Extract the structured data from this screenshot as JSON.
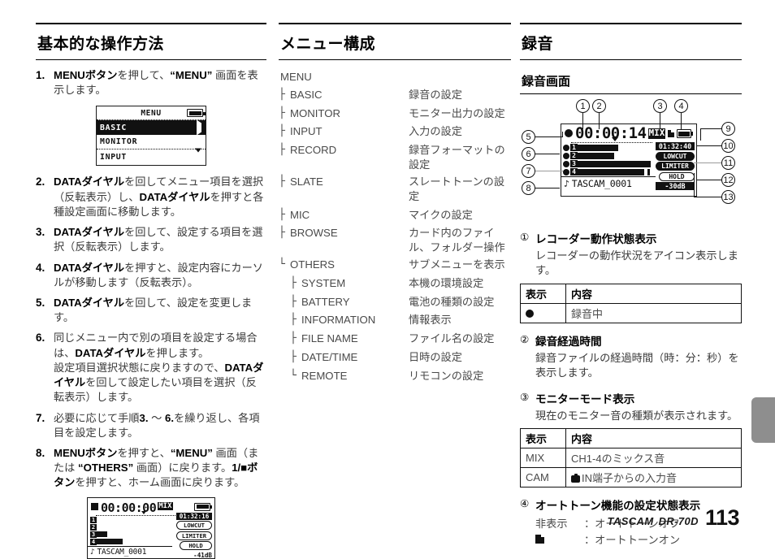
{
  "footer": {
    "brand": "TASCAM",
    "model": "DR-70D",
    "page_number": "113"
  },
  "col1": {
    "heading": "基本的な操作方法",
    "steps": [
      {
        "num": "1.",
        "html": "<span class=\"b\">MENU</span><span class=\"b\">ボタン</span>を押して、<span class=\"q\">“MENU”</span> 画面を表示します。"
      },
      {
        "num": "2.",
        "html": "<span class=\"b\">DATAダイヤル</span>を回してメニュー項目を選択（反転表示）し、<span class=\"b\">DATAダイヤル</span>を押すと各種設定画面に移動します。"
      },
      {
        "num": "3.",
        "html": "<span class=\"b\">DATAダイヤル</span>を回して、設定する項目を選択（反転表示）します。"
      },
      {
        "num": "4.",
        "html": "<span class=\"b\">DATAダイヤル</span>を押すと、設定内容にカーソルが移動します（反転表示）。"
      },
      {
        "num": "5.",
        "html": "<span class=\"b\">DATAダイヤル</span>を回して、設定を変更します。"
      },
      {
        "num": "6.",
        "html": "同じメニュー内で別の項目を設定する場合は、<span class=\"b\">DATAダイヤル</span>を押します。<br>設定項目選択状態に戻りますので、<span class=\"b\">DATAダイヤル</span>を回して設定したい項目を選択（反転表示）します。"
      },
      {
        "num": "7.",
        "html": "必要に応じて手順<span class=\"b\">3.</span> 〜 <span class=\"b\">6.</span>を繰り返し、各項目を設定します。"
      },
      {
        "num": "8.",
        "html": "<span class=\"b\">MENU</span><span class=\"b\">ボタン</span>を押すと、<span class=\"q\">“MENU”</span> 画面（または <span class=\"q\">“OTHERS”</span> 画面）に戻ります。<span class=\"b\">1/■ボタン</span>を押すと、ホーム画面に戻ります。"
      }
    ],
    "menu_lcd": {
      "title": "MENU",
      "battery_icon": "battery-icon",
      "rows": [
        {
          "label": "BASIC",
          "selected": true,
          "arrow": "right-arrow-icon"
        },
        {
          "label": "MONITOR",
          "selected": false,
          "arrow": ""
        },
        {
          "label": "INPUT",
          "selected": false,
          "arrow": "down-arrow-icon"
        }
      ]
    },
    "home_lcd": {
      "status_icon": "stop-icon",
      "elapsed_time": "00:00:00",
      "monitor_mode": "MIX",
      "battery_icon": "battery-icon",
      "remaining_time": "01:32:16",
      "lowcut": "LOWCUT",
      "limiter": "LIMITER",
      "hold": "HOLD",
      "level": "-41dB",
      "file_name": "TASCAM_0001",
      "channels": [
        "1",
        "2",
        "3",
        "4"
      ],
      "meter_levels": [
        0,
        0,
        22,
        55
      ]
    }
  },
  "col2": {
    "heading": "メニュー構成",
    "root": "MENU",
    "items": [
      {
        "glyph": "├",
        "label": "BASIC",
        "desc": "録音の設定",
        "level": 1
      },
      {
        "glyph": "├",
        "label": "MONITOR",
        "desc": "モニター出力の設定",
        "level": 1
      },
      {
        "glyph": "├",
        "label": "INPUT",
        "desc": "入力の設定",
        "level": 1
      },
      {
        "glyph": "├",
        "label": "RECORD",
        "desc": "録音フォーマットの設定",
        "level": 1
      },
      {
        "glyph": "├",
        "label": "SLATE",
        "desc": "スレートトーンの設定",
        "level": 1
      },
      {
        "glyph": "├",
        "label": "MIC",
        "desc": "マイクの設定",
        "level": 1
      },
      {
        "glyph": "├",
        "label": "BROWSE",
        "desc": "カード内のファイル、フォルダー操作",
        "level": 1
      },
      {
        "glyph": "└",
        "label": "OTHERS",
        "desc": "サブメニューを表示",
        "level": 1
      },
      {
        "glyph": "├",
        "label": "SYSTEM",
        "desc": "本機の環境設定",
        "level": 2
      },
      {
        "glyph": "├",
        "label": "BATTERY",
        "desc": "電池の種類の設定",
        "level": 2
      },
      {
        "glyph": "├",
        "label": "INFORMATION",
        "desc": "情報表示",
        "level": 2
      },
      {
        "glyph": "├",
        "label": "FILE NAME",
        "desc": "ファイル名の設定",
        "level": 2
      },
      {
        "glyph": "├",
        "label": "DATE/TIME",
        "desc": "日時の設定",
        "level": 2
      },
      {
        "glyph": "└",
        "label": "REMOTE",
        "desc": "リモコンの設定",
        "level": 2
      }
    ]
  },
  "col3": {
    "heading": "録音",
    "subheading": "録音画面",
    "rec_lcd": {
      "status_icon": "record-dot-icon",
      "elapsed_time": "00:00:14",
      "monitor_mode": "MIX",
      "autotone_icon": "autotone-icon",
      "battery_icon": "battery-icon",
      "remaining_time": "01:32:40",
      "lowcut": "LOWCUT",
      "limiter": "LIMITER",
      "hold": "HOLD",
      "level": "-30dB",
      "file_name": "TASCAM_0001",
      "channels": [
        "1",
        "2",
        "3",
        "4"
      ],
      "meter_levels": [
        45,
        40,
        80,
        73
      ]
    },
    "callouts": [
      "1",
      "2",
      "3",
      "4",
      "5",
      "6",
      "7",
      "8",
      "9",
      "10",
      "11",
      "12",
      "13"
    ],
    "sections": [
      {
        "num": "①",
        "title": "レコーダー動作状態表示",
        "body": "レコーダーの動作状況をアイコン表示します。",
        "table": {
          "headers": [
            "表示",
            "内容"
          ],
          "rows": [
            {
              "key_icon": "record-dot-icon",
              "key": "",
              "value": "録音中"
            }
          ]
        }
      },
      {
        "num": "②",
        "title": "録音経過時間",
        "body": "録音ファイルの経過時間（時：分：秒）を表示します。"
      },
      {
        "num": "③",
        "title": "モニターモード表示",
        "body": "現在のモニター音の種類が表示されます。",
        "table": {
          "headers": [
            "表示",
            "内容"
          ],
          "rows": [
            {
              "key": "MIX",
              "value": "CH1-4のミックス音"
            },
            {
              "key": "CAM",
              "value": "IN端子からの入力音",
              "value_icon": "camera-icon"
            }
          ]
        }
      },
      {
        "num": "④",
        "title": "オートトーン機能の設定状態表示",
        "kv": [
          {
            "k": "非表示",
            "v": "：オートトーンオフ"
          },
          {
            "k": "",
            "v": "：オートトーンオン",
            "k_icon": "autotone-icon"
          }
        ]
      }
    ]
  }
}
